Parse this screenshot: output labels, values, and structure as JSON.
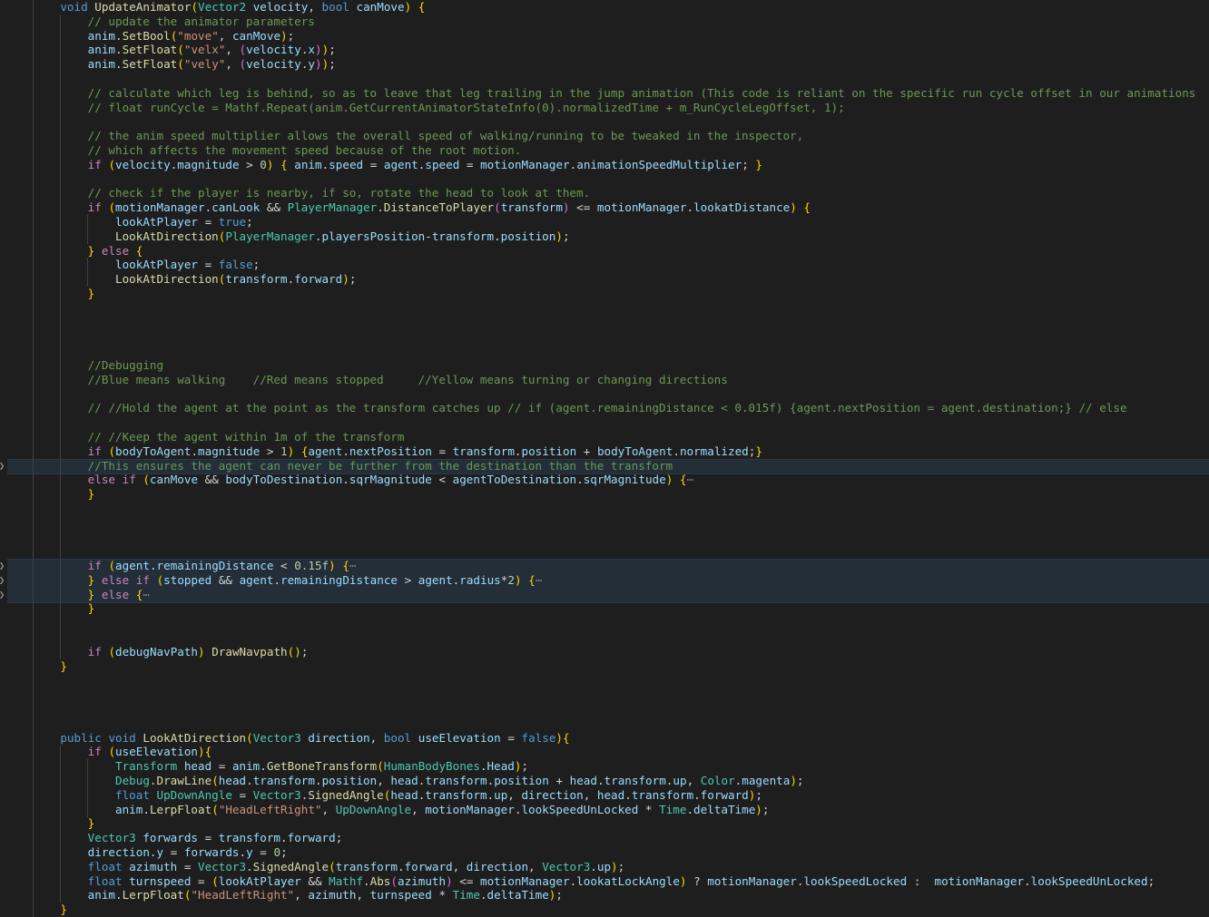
{
  "editor": {
    "language": "csharp",
    "theme": "Dark+ (default dark)",
    "background_color": "#1e1e1e",
    "folded_row_highlight_color": "#232e39",
    "indent_guide_color": "#404040",
    "font_size_px": 12.6,
    "line_height_px": 15.8,
    "fold_chevron_glyph": "❯",
    "fold_placeholder_glyph": "⋯",
    "colors": {
      "comment": "#6a9955",
      "keyword": "#569cd6",
      "control_keyword": "#c586c0",
      "type": "#4ec9b0",
      "function": "#dcdcaa",
      "variable": "#9cdcfe",
      "string": "#ce9178",
      "number": "#b5cea8",
      "plain": "#d4d4d4",
      "bracket_level_1": "#ffd700",
      "bracket_level_2": "#da70d6",
      "bracket_level_3": "#179fff"
    }
  },
  "code_lines": [
    "    void UpdateAnimator(Vector2 velocity, bool canMove) {",
    "        // update the animator parameters",
    "        anim.SetBool(\"move\", canMove);",
    "        anim.SetFloat(\"velx\", (velocity.x));",
    "        anim.SetFloat(\"vely\", (velocity.y));",
    "",
    "        // calculate which leg is behind, so as to leave that leg trailing in the jump animation (This code is reliant on the specific run cycle offset in our animations",
    "        // float runCycle = Mathf.Repeat(anim.GetCurrentAnimatorStateInfo(0).normalizedTime + m_RunCycleLegOffset, 1);",
    "",
    "        // the anim speed multiplier allows the overall speed of walking/running to be tweaked in the inspector,",
    "        // which affects the movement speed because of the root motion.",
    "        if (velocity.magnitude > 0) { anim.speed = agent.speed = motionManager.animationSpeedMultiplier; }",
    "",
    "        // check if the player is nearby, if so, rotate the head to look at them.",
    "        if (motionManager.canLook && PlayerManager.DistanceToPlayer(transform) <= motionManager.lookatDistance) {",
    "            lookAtPlayer = true;",
    "            LookAtDirection(PlayerManager.playersPosition-transform.position);",
    "        } else {",
    "            lookAtPlayer = false;",
    "            LookAtDirection(transform.forward);",
    "        }",
    "",
    "",
    "",
    "",
    "        //Debugging",
    "        //Blue means walking    //Red means stopped     //Yellow means turning or changing directions",
    "",
    "        // //Hold the agent at the point as the transform catches up // if (agent.remainingDistance < 0.015f) {agent.nextPosition = agent.destination;} // else",
    "",
    "        // //Keep the agent within 1m of the transform",
    "        if (bodyToAgent.magnitude > 1) {agent.nextPosition = transform.position + bodyToAgent.normalized;}",
    "        //This ensures the agent can never be further from the destination than the transform",
    "        else if (canMove && bodyToDestination.sqrMagnitude < agentToDestination.sqrMagnitude) {⋯",
    "        }",
    "",
    "",
    "",
    "",
    "        if (agent.remainingDistance < 0.15f) {⋯",
    "        } else if (stopped && agent.remainingDistance > agent.radius*2) {⋯",
    "        } else {⋯",
    "        }",
    "",
    "",
    "        if (debugNavPath) DrawNavpath();",
    "    }",
    "",
    "",
    "",
    "",
    "    public void LookAtDirection(Vector3 direction, bool useElevation = false){",
    "        if (useElevation){",
    "            Transform head = anim.GetBoneTransform(HumanBodyBones.Head);",
    "            Debug.DrawLine(head.transform.position, head.transform.position + head.transform.up, Color.magenta);",
    "            float UpDownAngle = Vector3.SignedAngle(head.transform.up, direction, head.transform.forward);",
    "            anim.LerpFloat(\"HeadLeftRight\", UpDownAngle, motionManager.lookSpeedUnLocked * Time.deltaTime);",
    "        }",
    "        Vector3 forwards = transform.forward;",
    "        direction.y = forwards.y = 0;",
    "        float azimuth = Vector3.SignedAngle(transform.forward, direction, Vector3.up);",
    "        float turnspeed = (lookAtPlayer && Mathf.Abs(azimuth) <= motionManager.lookatLockAngle) ? motionManager.lookSpeedLocked :  motionManager.lookSpeedUnLocked;",
    "        anim.LerpFloat(\"HeadLeftRight\", azimuth, turnspeed * Time.deltaTime);",
    "    }"
  ],
  "folded_regions": [
    {
      "line_index": 32,
      "label": "else if (canMove && bodyToDestination.sqrMagnitude < agentToDestination.sqrMagnitude) {⋯"
    },
    {
      "line_index": 39,
      "label": "if (agent.remainingDistance < 0.15f) {⋯"
    },
    {
      "line_index": 40,
      "label": "} else if (stopped && agent.remainingDistance > agent.radius*2) {⋯"
    },
    {
      "line_index": 41,
      "label": "} else {⋯"
    }
  ],
  "fold_chevrons": [
    {
      "line_index": 32,
      "glyph": "❯",
      "name": "fold-chevron-collapsed"
    },
    {
      "line_index": 39,
      "glyph": "❯",
      "name": "fold-chevron-collapsed"
    },
    {
      "line_index": 40,
      "glyph": "❯",
      "name": "fold-chevron-collapsed"
    },
    {
      "line_index": 41,
      "glyph": "❯",
      "name": "fold-chevron-collapsed"
    }
  ]
}
